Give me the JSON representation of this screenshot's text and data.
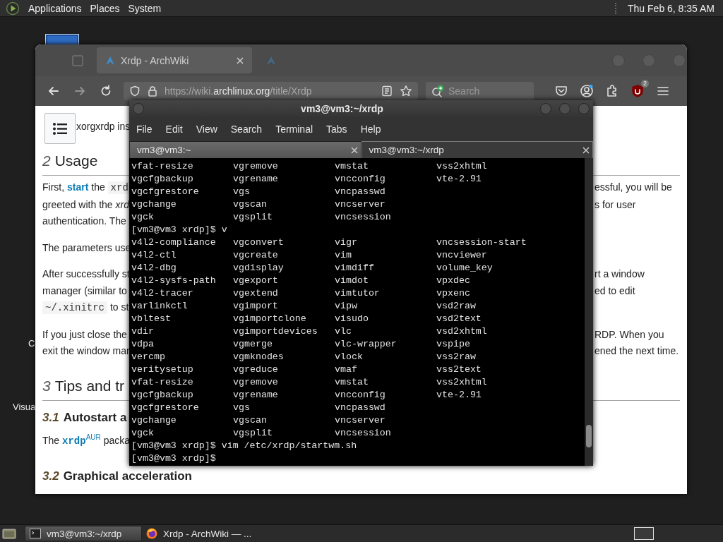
{
  "top_panel": {
    "menus": [
      "Applications",
      "Places",
      "System"
    ],
    "clock": "Thu Feb 6, 8:35 AM"
  },
  "desktop_icons": [
    {
      "label": "C"
    },
    {
      "label": "Visua"
    }
  ],
  "browser": {
    "tabs": [
      {
        "title": "Xrdp - ArchWiki",
        "selected": true
      },
      {
        "selected": false
      }
    ],
    "url": {
      "scheme": "https://wiki.",
      "domain": "archlinux.org",
      "path": "/title/Xrdp"
    },
    "search": {
      "placeholder": "Search"
    },
    "extension_badge": "2",
    "page": {
      "toc_line": "xorgxrdp ins",
      "blocks": [
        {
          "kind": "h2",
          "number": "2",
          "title": "Usage"
        },
        {
          "kind": "p",
          "lines": [
            {
              "left": [
                {
                  "kind": "plain",
                  "text": "First, "
                },
                {
                  "kind": "link",
                  "text": "start"
                },
                {
                  "kind": "plain",
                  "text": " the "
                },
                {
                  "kind": "code",
                  "text": "xrd"
                }
              ],
              "right": "essful, you will be"
            },
            {
              "left": [
                {
                  "kind": "plain",
                  "text": "greeted with the "
                },
                {
                  "kind": "italic",
                  "text": "xrd"
                }
              ],
              "right": "s for user"
            },
            {
              "left": [
                {
                  "kind": "plain",
                  "text": "authentication. The"
                }
              ]
            }
          ]
        },
        {
          "kind": "p",
          "lines": [
            {
              "left": [
                {
                  "kind": "plain",
                  "text": "The parameters use"
                }
              ]
            }
          ]
        },
        {
          "kind": "p",
          "lines": [
            {
              "left": [
                {
                  "kind": "plain",
                  "text": "After successfully st"
                }
              ],
              "right": "rt a window"
            },
            {
              "left": [
                {
                  "kind": "plain",
                  "text": "manager (similar to"
                }
              ],
              "right": "ed to edit"
            },
            {
              "left": [
                {
                  "kind": "code",
                  "text": "~/.xinitrc"
                },
                {
                  "kind": "plain",
                  "text": " to st"
                }
              ]
            }
          ]
        },
        {
          "kind": "p",
          "lines": [
            {
              "left": [
                {
                  "kind": "plain",
                  "text": "If you just close the"
                }
              ],
              "right": "RDP. When you"
            },
            {
              "left": [
                {
                  "kind": "plain",
                  "text": "exit the window mar"
                }
              ],
              "right": "ened the next time."
            }
          ]
        },
        {
          "kind": "h2",
          "number": "3",
          "title": "Tips and tr"
        },
        {
          "kind": "h3",
          "number": "3.1",
          "title": "Autostart a"
        },
        {
          "kind": "p",
          "lines": [
            {
              "left": [
                {
                  "kind": "plain",
                  "text": "The "
                },
                {
                  "kind": "codelink",
                  "text": "xrdp"
                },
                {
                  "kind": "sup",
                  "text": "AUR"
                },
                {
                  "kind": "plain",
                  "text": " packa"
                }
              ]
            }
          ]
        },
        {
          "kind": "h3",
          "number": "3.2",
          "title": "Graphical acceleration"
        }
      ]
    }
  },
  "terminal": {
    "title": "vm3@vm3:~/xrdp",
    "menus": [
      "File",
      "Edit",
      "View",
      "Search",
      "Terminal",
      "Tabs",
      "Help"
    ],
    "tabs": [
      {
        "title": "vm3@vm3:~",
        "selected": false
      },
      {
        "title": "vm3@vm3:~/xrdp",
        "selected": true
      }
    ],
    "lines": [
      {
        "kind": "columns",
        "cells": [
          "vfat-resize",
          "vgremove",
          "vmstat",
          "vss2xhtml"
        ]
      },
      {
        "kind": "columns",
        "cells": [
          "vgcfgbackup",
          "vgrename",
          "vncconfig",
          "vte-2.91"
        ]
      },
      {
        "kind": "columns",
        "cells": [
          "vgcfgrestore",
          "vgs",
          "vncpasswd"
        ]
      },
      {
        "kind": "columns",
        "cells": [
          "vgchange",
          "vgscan",
          "vncserver"
        ]
      },
      {
        "kind": "columns",
        "cells": [
          "vgck",
          "vgsplit",
          "vncsession"
        ]
      },
      {
        "kind": "prompt",
        "text": "[vm3@vm3 xrdp]$ v"
      },
      {
        "kind": "columns",
        "cells": [
          "v4l2-compliance",
          "vgconvert",
          "vigr",
          "vncsession-start"
        ]
      },
      {
        "kind": "columns",
        "cells": [
          "v4l2-ctl",
          "vgcreate",
          "vim",
          "vncviewer"
        ]
      },
      {
        "kind": "columns",
        "cells": [
          "v4l2-dbg",
          "vgdisplay",
          "vimdiff",
          "volume_key"
        ]
      },
      {
        "kind": "columns",
        "cells": [
          "v4l2-sysfs-path",
          "vgexport",
          "vimdot",
          "vpxdec"
        ]
      },
      {
        "kind": "columns",
        "cells": [
          "v4l2-tracer",
          "vgextend",
          "vimtutor",
          "vpxenc"
        ]
      },
      {
        "kind": "columns",
        "cells": [
          "varlinkctl",
          "vgimport",
          "vipw",
          "vsd2raw"
        ]
      },
      {
        "kind": "columns",
        "cells": [
          "vbltest",
          "vgimportclone",
          "visudo",
          "vsd2text"
        ]
      },
      {
        "kind": "columns",
        "cells": [
          "vdir",
          "vgimportdevices",
          "vlc",
          "vsd2xhtml"
        ]
      },
      {
        "kind": "columns",
        "cells": [
          "vdpa",
          "vgmerge",
          "vlc-wrapper",
          "vspipe"
        ]
      },
      {
        "kind": "columns",
        "cells": [
          "vercmp",
          "vgmknodes",
          "vlock",
          "vss2raw"
        ]
      },
      {
        "kind": "columns",
        "cells": [
          "veritysetup",
          "vgreduce",
          "vmaf",
          "vss2text"
        ]
      },
      {
        "kind": "columns",
        "cells": [
          "vfat-resize",
          "vgremove",
          "vmstat",
          "vss2xhtml"
        ]
      },
      {
        "kind": "columns",
        "cells": [
          "vgcfgbackup",
          "vgrename",
          "vncconfig",
          "vte-2.91"
        ]
      },
      {
        "kind": "columns",
        "cells": [
          "vgcfgrestore",
          "vgs",
          "vncpasswd"
        ]
      },
      {
        "kind": "columns",
        "cells": [
          "vgchange",
          "vgscan",
          "vncserver"
        ]
      },
      {
        "kind": "columns",
        "cells": [
          "vgck",
          "vgsplit",
          "vncsession"
        ]
      },
      {
        "kind": "prompt",
        "text": "[vm3@vm3 xrdp]$ vim /etc/xrdp/startwm.sh"
      },
      {
        "kind": "prompt",
        "text": "[vm3@vm3 xrdp]$"
      }
    ]
  },
  "taskbar": {
    "tasks": [
      {
        "title": "vm3@vm3:~/xrdp",
        "kind": "terminal",
        "selected": true
      },
      {
        "title": "Xrdp - ArchWiki — ...",
        "kind": "browser",
        "selected": false
      }
    ]
  }
}
